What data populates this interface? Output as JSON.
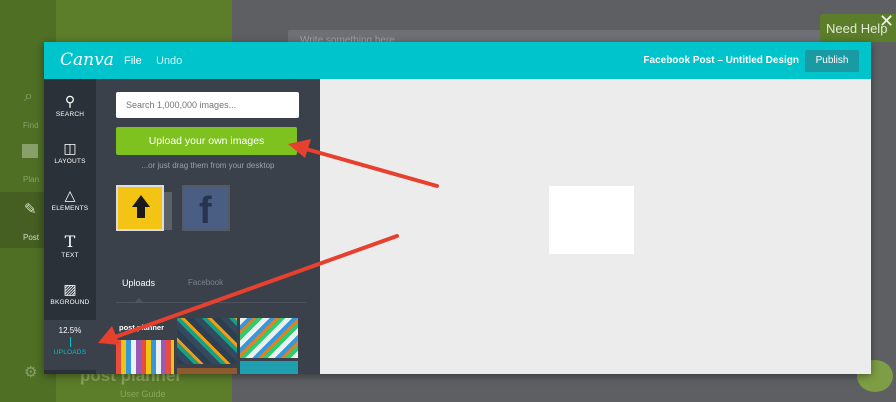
{
  "background_app": {
    "nav": [
      {
        "label": "Find",
        "icon": "search-icon"
      },
      {
        "label": "Plan",
        "icon": "calendar-icon"
      },
      {
        "label": "Post",
        "icon": "pencil-icon"
      }
    ],
    "compose_placeholder": "Write something here",
    "need_help": "Need Help",
    "logo": "post planner",
    "user_guide": "User Guide",
    "colors": {
      "nav_green": "#4e6f24",
      "sidebar_green": "#5c7d2a"
    }
  },
  "canva": {
    "logo": "Canva",
    "menu": {
      "file": "File",
      "undo": "Undo"
    },
    "doc_title": "Facebook Post – Untitled Design",
    "publish_label": "Publish",
    "colors": {
      "header": "#00c4cc",
      "upload_button": "#7dc21e",
      "rail": "#2b3138",
      "panel": "#3a414a"
    },
    "tools": [
      {
        "label": "SEARCH",
        "icon": "search-icon"
      },
      {
        "label": "LAYOUTS",
        "icon": "layouts-icon"
      },
      {
        "label": "ELEMENTS",
        "icon": "elements-icon"
      },
      {
        "label": "TEXT",
        "icon": "text-icon"
      },
      {
        "label": "BKGROUND",
        "icon": "background-icon"
      },
      {
        "label": "UPLOADS",
        "icon": "upload-icon",
        "progress": "12.5%"
      }
    ],
    "panel": {
      "search_placeholder": "Search 1,000,000 images...",
      "upload_button": "Upload your own images",
      "drag_hint": "...or just drag them from your desktop",
      "sources": [
        {
          "label": "Uploads",
          "icon": "upload-arrow-icon",
          "selected": true
        },
        {
          "label": "Facebook",
          "icon": "facebook-icon",
          "selected": false
        }
      ],
      "thumbnail_brand": "post planner"
    }
  }
}
